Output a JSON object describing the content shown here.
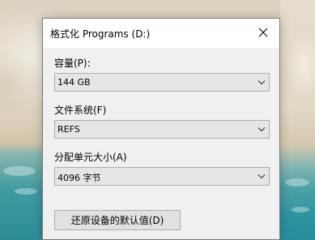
{
  "dialog": {
    "title": "格式化 Programs (D:)",
    "capacity": {
      "label": "容量(P):",
      "value": "144 GB"
    },
    "filesystem": {
      "label": "文件系统(F)",
      "value": "REFS"
    },
    "allocation": {
      "label": "分配单元大小(A)",
      "value": "4096 字节"
    },
    "restore_defaults_label": "还原设备的默认值(D)"
  },
  "icons": {
    "close": "close-icon",
    "dropdown": "chevron-down-icon"
  },
  "colors": {
    "dialog_bg": "#f0f0f0",
    "titlebar_bg": "#ffffff",
    "combo_bg": "#e5e5e5",
    "border": "#adadad"
  }
}
